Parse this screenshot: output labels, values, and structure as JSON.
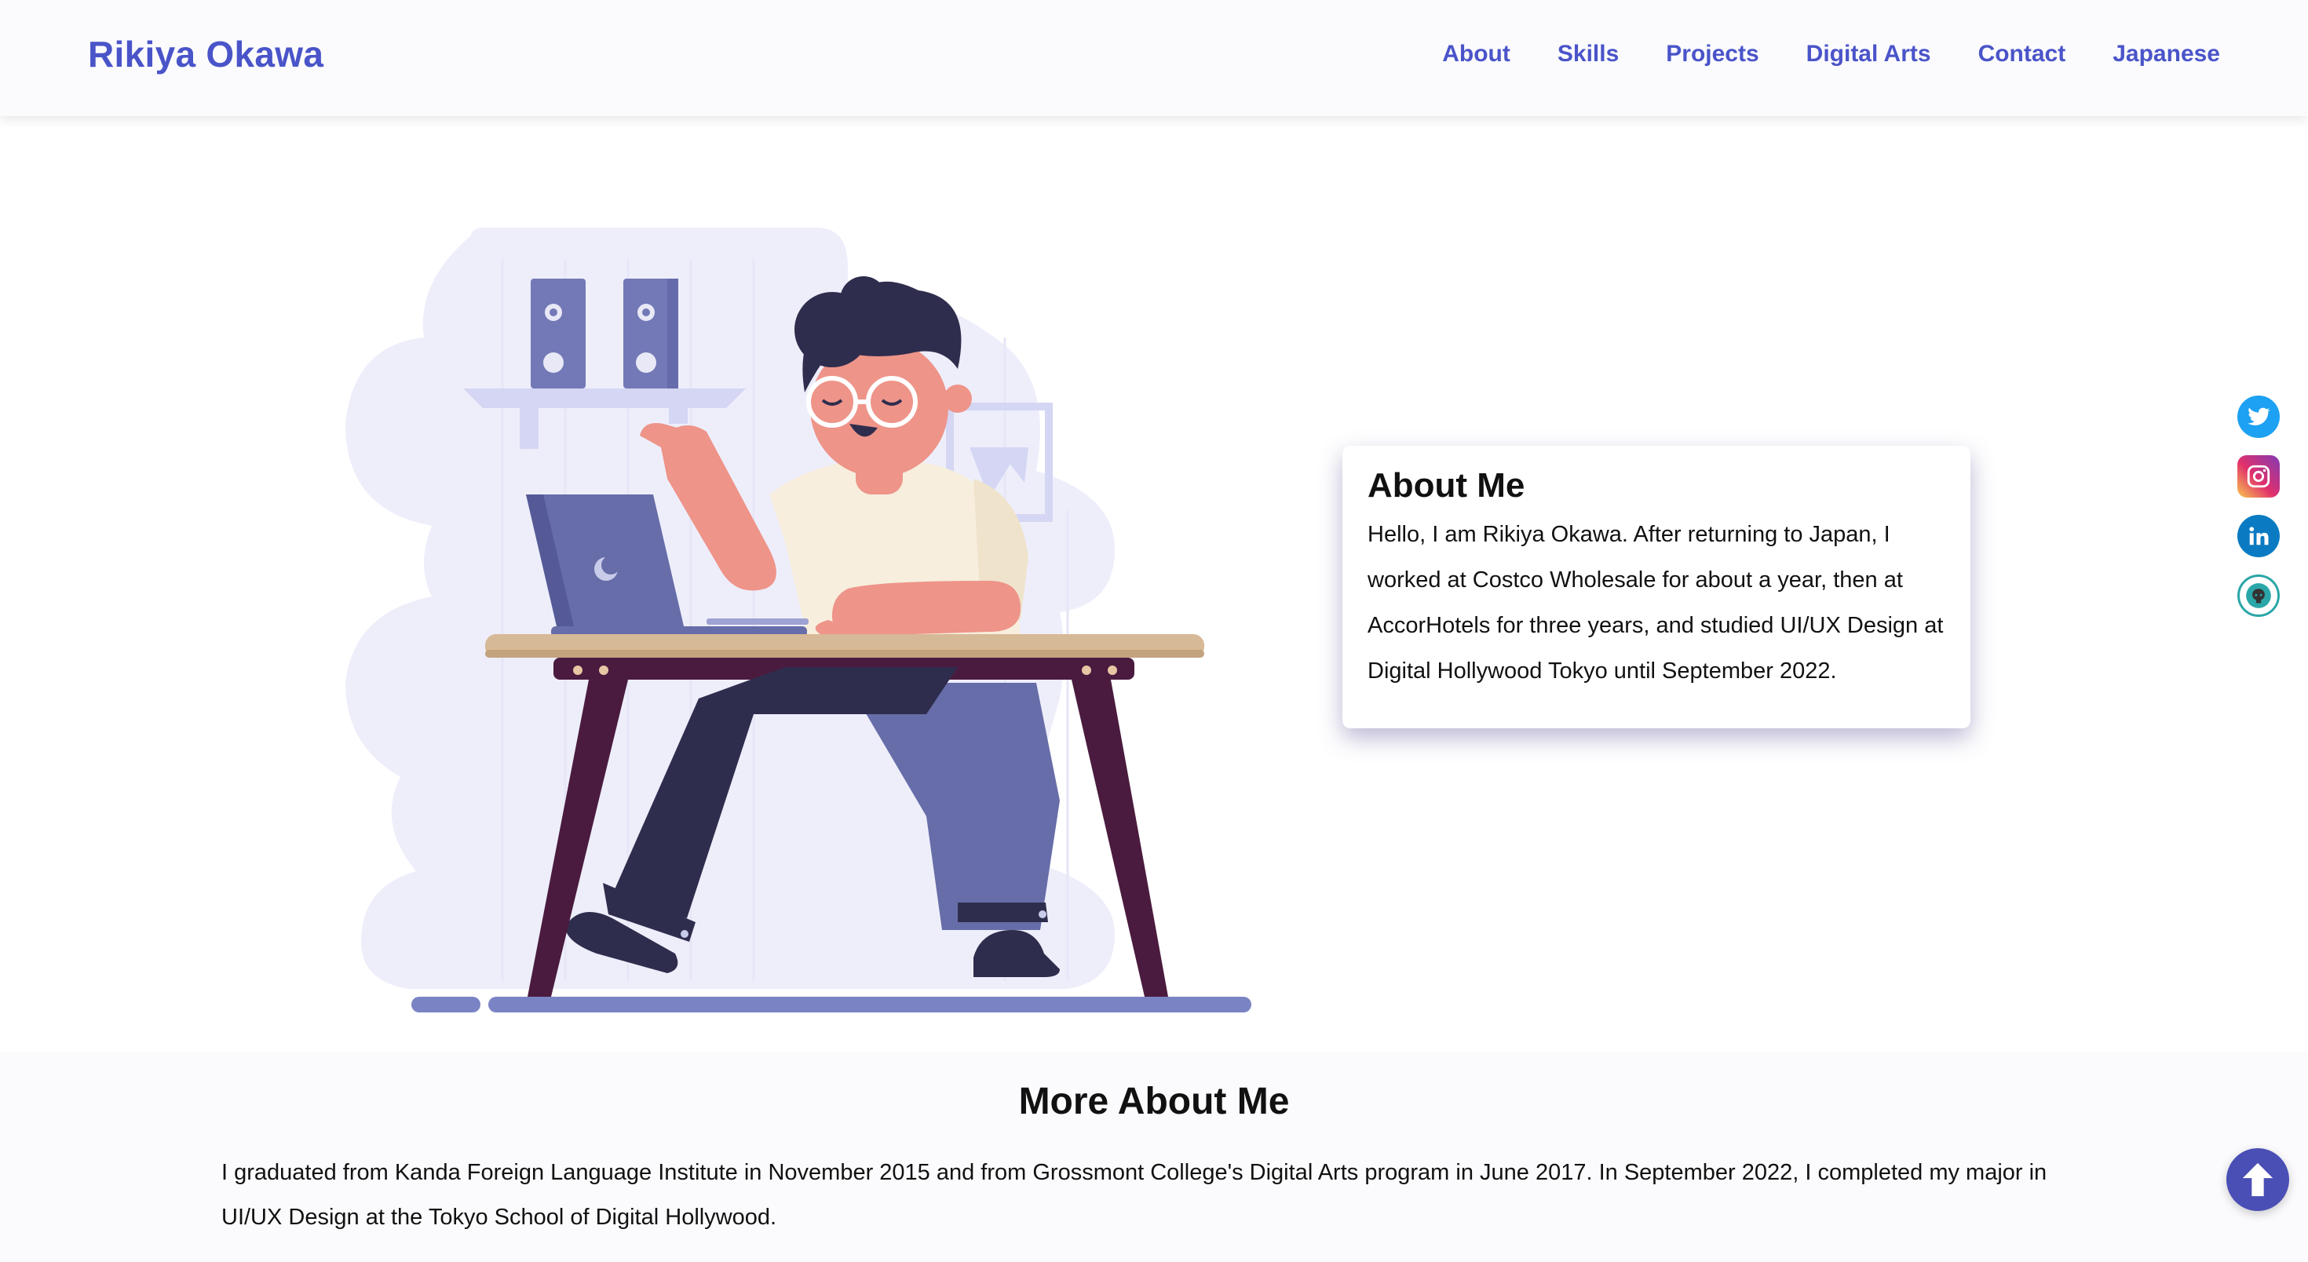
{
  "header": {
    "brand": "Rikiya Okawa",
    "nav": [
      "About",
      "Skills",
      "Projects",
      "Digital Arts",
      "Contact",
      "Japanese"
    ]
  },
  "about": {
    "title": "About Me",
    "text": "Hello, I am Rikiya Okawa. After returning to Japan, I worked at Costco Wholesale for about a year, then at AccorHotels for three years, and studied UI/UX Design at Digital Hollywood Tokyo until September 2022."
  },
  "socials": [
    {
      "name": "twitter-icon",
      "color": "#1da1f2"
    },
    {
      "name": "instagram-icon",
      "color": "#c13584"
    },
    {
      "name": "linkedin-icon",
      "color": "#0a7bc2"
    },
    {
      "name": "github-icon",
      "color": "#2aa6a8"
    }
  ],
  "more": {
    "title": "More About Me",
    "text": "I graduated from Kanda Foreign Language Institute in November 2015 and from Grossmont College's Digital Arts program in June 2017. In September 2022, I completed my major in UI/UX Design at the Tokyo School of Digital Hollywood."
  },
  "colors": {
    "accent": "#4a54c9",
    "scroll_button": "#4a4fb5"
  }
}
